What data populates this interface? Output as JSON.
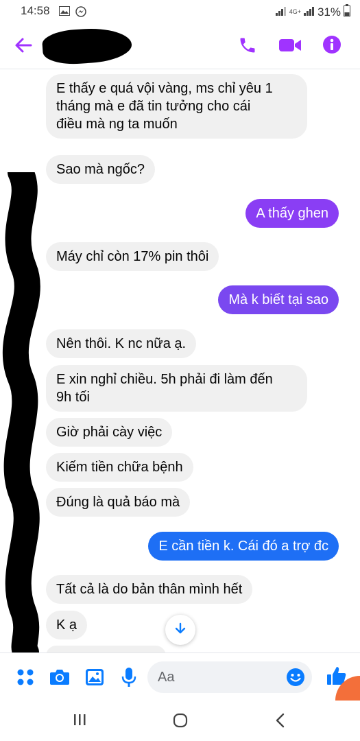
{
  "status_bar": {
    "time": "14:58",
    "network": "4G+",
    "battery": "31%"
  },
  "header": {
    "contact_name_redacted": true,
    "icons": [
      "back-arrow-icon",
      "phone-icon",
      "video-camera-icon",
      "info-icon"
    ],
    "accent_color": "#a033ff"
  },
  "messages": [
    {
      "direction": "incoming",
      "text": "E thấy e quá vội vàng, ms chỉ yêu 1\ntháng mà e đã tin tưởng cho cái\nđiều mà ng ta muốn"
    },
    {
      "direction": "incoming",
      "text": "Sao mà ngốc?"
    },
    {
      "direction": "outgoing",
      "text": "A thấy ghen",
      "color": "#8a3ef4"
    },
    {
      "direction": "incoming",
      "text": "Máy chỉ còn 17% pin thôi"
    },
    {
      "direction": "outgoing",
      "text": "Mà k biết tại sao",
      "color": "#7a48f0"
    },
    {
      "direction": "incoming",
      "text": "Nên thôi. K nc nữa ạ."
    },
    {
      "direction": "incoming",
      "text": "E xin nghỉ chiều. 5h phải đi làm đến\n9h tối"
    },
    {
      "direction": "incoming",
      "text": "Giờ phải cày việc"
    },
    {
      "direction": "incoming",
      "text": "Kiếm tiền chữa bệnh"
    },
    {
      "direction": "incoming",
      "text": "Đúng là quả báo mà"
    },
    {
      "direction": "outgoing",
      "text": "E cần tiền k. Cái đó a  trợ đc",
      "color": "#1e6ff5"
    },
    {
      "direction": "incoming",
      "text": "Tất cả là do bản thân mình hết"
    },
    {
      "direction": "incoming",
      "text": "K ạ"
    }
  ],
  "composer": {
    "placeholder": "Aa",
    "icons": [
      "menu-dots-icon",
      "camera-icon",
      "gallery-icon",
      "microphone-icon",
      "emoji-icon",
      "like-icon"
    ],
    "accent_color": "#0a7cff"
  },
  "nav_bar": {
    "icons": [
      "recent-apps-icon",
      "home-icon",
      "back-icon"
    ]
  }
}
